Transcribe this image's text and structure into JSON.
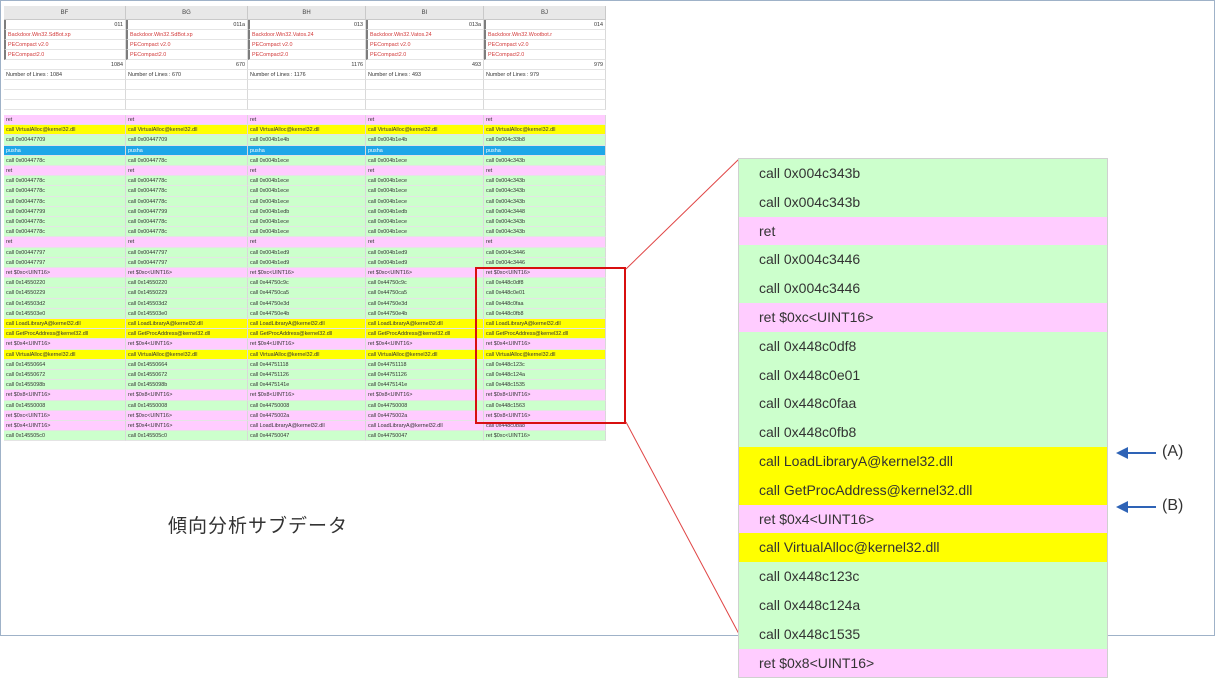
{
  "columns": [
    "BF",
    "BG",
    "BH",
    "BI",
    "BJ"
  ],
  "ids": [
    "011",
    "011a",
    "013",
    "013a",
    "014"
  ],
  "malware": [
    "Backdoor.Win32.SdBot.xp",
    "Backdoor.Win32.SdBot.xp",
    "Backdoor.Win32.Vatos.24",
    "Backdoor.Win32.Vatos.24",
    "Backdoor.Win32.Wootbot.r"
  ],
  "packer1": [
    "PECompact v2.0",
    "PECompact v2.0",
    "PECompact v2.0",
    "PECompact v2.0",
    "PECompact v2.0"
  ],
  "packer2": [
    "PECompact2.0",
    "PECompact2.0",
    "PECompact2.0",
    "PECompact2.0",
    "PECompact2.0"
  ],
  "counts": [
    "1084",
    "670",
    "1176",
    "493",
    "979"
  ],
  "lines_text": [
    "Number of Lines : 1084",
    "Number of Lines : 670",
    "Number of Lines : 1176",
    "Number of Lines : 493",
    "Number of Lines : 979"
  ],
  "rows": [
    {
      "c": "p",
      "v": [
        "ret",
        "ret",
        "ret",
        "ret",
        "ret"
      ]
    },
    {
      "c": "y",
      "v": [
        "call VirtualAlloc@kernel32.dll",
        "call VirtualAlloc@kernel32.dll",
        "call VirtualAlloc@kernel32.dll",
        "call VirtualAlloc@kernel32.dll",
        "call VirtualAlloc@kernel32.dll"
      ]
    },
    {
      "c": "g",
      "v": [
        "call 0x00447709",
        "call 0x00447709",
        "call 0x004b1e4b",
        "call 0x004b1e4b",
        "call 0x004c33b8"
      ]
    },
    {
      "c": "b",
      "v": [
        "pusha",
        "pusha",
        "pusha",
        "pusha",
        "pusha"
      ]
    },
    {
      "c": "g",
      "v": [
        "call 0x0044778c",
        "call 0x0044778c",
        "call 0x004b1ece",
        "call 0x004b1ece",
        "call 0x004c343b"
      ]
    },
    {
      "c": "p",
      "v": [
        "ret",
        "ret",
        "ret",
        "ret",
        "ret"
      ]
    },
    {
      "c": "g",
      "v": [
        "call 0x0044778c",
        "call 0x0044778c",
        "call 0x004b1ece",
        "call 0x004b1ece",
        "call 0x004c343b"
      ]
    },
    {
      "c": "g",
      "v": [
        "call 0x0044778c",
        "call 0x0044778c",
        "call 0x004b1ece",
        "call 0x004b1ece",
        "call 0x004c343b"
      ]
    },
    {
      "c": "g",
      "v": [
        "call 0x0044778c",
        "call 0x0044778c",
        "call 0x004b1ece",
        "call 0x004b1ece",
        "call 0x004c343b"
      ]
    },
    {
      "c": "g",
      "v": [
        "call 0x00447799",
        "call 0x00447799",
        "call 0x004b1edb",
        "call 0x004b1edb",
        "call 0x004c3448"
      ]
    },
    {
      "c": "g",
      "v": [
        "call 0x0044778c",
        "call 0x0044778c",
        "call 0x004b1ece",
        "call 0x004b1ece",
        "call 0x004c343b"
      ]
    },
    {
      "c": "g",
      "v": [
        "call 0x0044778c",
        "call 0x0044778c",
        "call 0x004b1ece",
        "call 0x004b1ece",
        "call 0x004c343b"
      ]
    },
    {
      "c": "p",
      "v": [
        "ret",
        "ret",
        "ret",
        "ret",
        "ret"
      ]
    },
    {
      "c": "g",
      "v": [
        "call 0x00447797",
        "call 0x00447797",
        "call 0x004b1ed9",
        "call 0x004b1ed9",
        "call 0x004c3446"
      ]
    },
    {
      "c": "g",
      "v": [
        "call 0x00447797",
        "call 0x00447797",
        "call 0x004b1ed9",
        "call 0x004b1ed9",
        "call 0x004c3446"
      ]
    },
    {
      "c": "p",
      "v": [
        "ret $0xc<UINT16>",
        "ret $0xc<UINT16>",
        "ret $0xc<UINT16>",
        "ret $0xc<UINT16>",
        "ret $0xc<UINT16>"
      ]
    },
    {
      "c": "g",
      "v": [
        "call 0x14550220",
        "call 0x14550220",
        "call 0x44750c9c",
        "call 0x44750c9c",
        "call 0x448c0df8"
      ]
    },
    {
      "c": "g",
      "v": [
        "call 0x14550229",
        "call 0x14550229",
        "call 0x44750ca5",
        "call 0x44750ca5",
        "call 0x448c0e01"
      ]
    },
    {
      "c": "g",
      "v": [
        "call 0x145503d2",
        "call 0x145503d2",
        "call 0x44750e3d",
        "call 0x44750e3d",
        "call 0x448c0faa"
      ]
    },
    {
      "c": "g",
      "v": [
        "call 0x145503e0",
        "call 0x145503e0",
        "call 0x44750e4b",
        "call 0x44750e4b",
        "call 0x448c0fb8"
      ]
    },
    {
      "c": "y",
      "v": [
        "call LoadLibraryA@kernel32.dll",
        "call LoadLibraryA@kernel32.dll",
        "call LoadLibraryA@kernel32.dll",
        "call LoadLibraryA@kernel32.dll",
        "call LoadLibraryA@kernel32.dll"
      ]
    },
    {
      "c": "y",
      "v": [
        "call GetProcAddress@kernel32.dll",
        "call GetProcAddress@kernel32.dll",
        "call GetProcAddress@kernel32.dll",
        "call GetProcAddress@kernel32.dll",
        "call GetProcAddress@kernel32.dll"
      ]
    },
    {
      "c": "p",
      "v": [
        "ret $0x4<UINT16>",
        "ret $0x4<UINT16>",
        "ret $0x4<UINT16>",
        "ret $0x4<UINT16>",
        "ret $0x4<UINT16>"
      ]
    },
    {
      "c": "y",
      "v": [
        "call VirtualAlloc@kernel32.dll",
        "call VirtualAlloc@kernel32.dll",
        "call VirtualAlloc@kernel32.dll",
        "call VirtualAlloc@kernel32.dll",
        "call VirtualAlloc@kernel32.dll"
      ]
    },
    {
      "c": "g",
      "v": [
        "call 0x14550664",
        "call 0x14550664",
        "call 0x44751118",
        "call 0x44751118",
        "call 0x448c123c"
      ]
    },
    {
      "c": "g",
      "v": [
        "call 0x14550672",
        "call 0x14550672",
        "call 0x44751126",
        "call 0x44751126",
        "call 0x448c124a"
      ]
    },
    {
      "c": "g",
      "v": [
        "call 0x1455098b",
        "call 0x1455098b",
        "call 0x4475141e",
        "call 0x4475141e",
        "call 0x448c1535"
      ]
    },
    {
      "c": "p",
      "v": [
        "ret $0x8<UINT16>",
        "ret $0x8<UINT16>",
        "ret $0x8<UINT16>",
        "ret $0x8<UINT16>",
        "ret $0x8<UINT16>"
      ]
    },
    {
      "c": "g",
      "v": [
        "call 0x14550008",
        "call 0x14550008",
        "call 0x44750008",
        "call 0x44750008",
        "call 0x448c1563"
      ]
    },
    {
      "c": "p",
      "v": [
        "ret $0xc<UINT16>",
        "ret $0xc<UINT16>",
        "call 0x4475002a",
        "call 0x4475002a",
        "ret $0x8<UINT16>"
      ]
    },
    {
      "c": "p",
      "v": [
        "ret $0x4<UINT16>",
        "ret $0x4<UINT16>",
        "call LoadLibraryA@kernel32.dll",
        "call LoadLibraryA@kernel32.dll",
        "call 0x448c0ba8"
      ]
    },
    {
      "c": "g",
      "v": [
        "call 0x145505c0",
        "call 0x145505c0",
        "call 0x44750047",
        "call 0x44750047",
        "ret $0xc<UINT16>"
      ]
    }
  ],
  "caption": "傾向分析サブデータ",
  "zoom_rows": [
    {
      "c": "g",
      "t": "call 0x004c343b"
    },
    {
      "c": "g",
      "t": "call 0x004c343b"
    },
    {
      "c": "p",
      "t": "ret"
    },
    {
      "c": "g",
      "t": "call 0x004c3446"
    },
    {
      "c": "g",
      "t": "call 0x004c3446"
    },
    {
      "c": "p",
      "t": "ret $0xc<UINT16>"
    },
    {
      "c": "g",
      "t": "call 0x448c0df8"
    },
    {
      "c": "g",
      "t": "call 0x448c0e01"
    },
    {
      "c": "g",
      "t": "call 0x448c0faa"
    },
    {
      "c": "g",
      "t": "call 0x448c0fb8"
    },
    {
      "c": "y",
      "t": "call LoadLibraryA@kernel32.dll"
    },
    {
      "c": "y",
      "t": "call GetProcAddress@kernel32.dll"
    },
    {
      "c": "p",
      "t": "ret $0x4<UINT16>"
    },
    {
      "c": "y",
      "t": "call VirtualAlloc@kernel32.dll"
    },
    {
      "c": "g",
      "t": "call 0x448c123c"
    },
    {
      "c": "g",
      "t": "call 0x448c124a"
    },
    {
      "c": "g",
      "t": "call 0x448c1535"
    },
    {
      "c": "p",
      "t": "ret $0x8<UINT16>"
    }
  ],
  "markers": {
    "a": "(A)",
    "b": "(B)"
  },
  "colors": {
    "call": "#ccffcc",
    "ret": "#ffccff",
    "api": "#ffff00",
    "pusha": "#1ea7e8",
    "highlight": "#d80f0f",
    "arrow": "#2e63b6"
  }
}
